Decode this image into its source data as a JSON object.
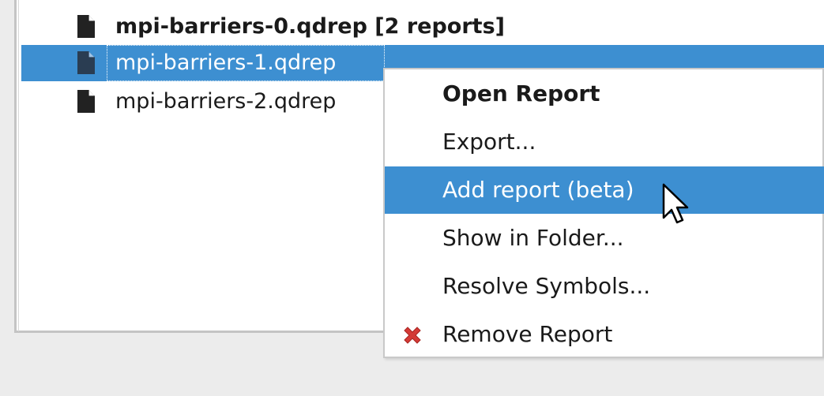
{
  "tree": {
    "rows": [
      {
        "label": "mpi-barriers-0.qdrep [2 reports]",
        "icon": "file-icon",
        "bold": true
      },
      {
        "label": "mpi-barriers-1.qdrep",
        "icon": "file-icon",
        "selected": true
      },
      {
        "label": "mpi-barriers-2.qdrep",
        "icon": "file-icon"
      }
    ]
  },
  "context_menu": {
    "items": [
      {
        "label": "Open Report",
        "default": true
      },
      {
        "label": "Export..."
      },
      {
        "label": "Add report (beta)",
        "highlighted": true
      },
      {
        "label": "Show in Folder..."
      },
      {
        "label": "Resolve Symbols..."
      },
      {
        "label": "Remove Report",
        "icon": "red-x-icon"
      }
    ]
  },
  "colors": {
    "selection": "#3d8fd1",
    "background": "#ececec",
    "remove_icon": "#d43a36"
  }
}
